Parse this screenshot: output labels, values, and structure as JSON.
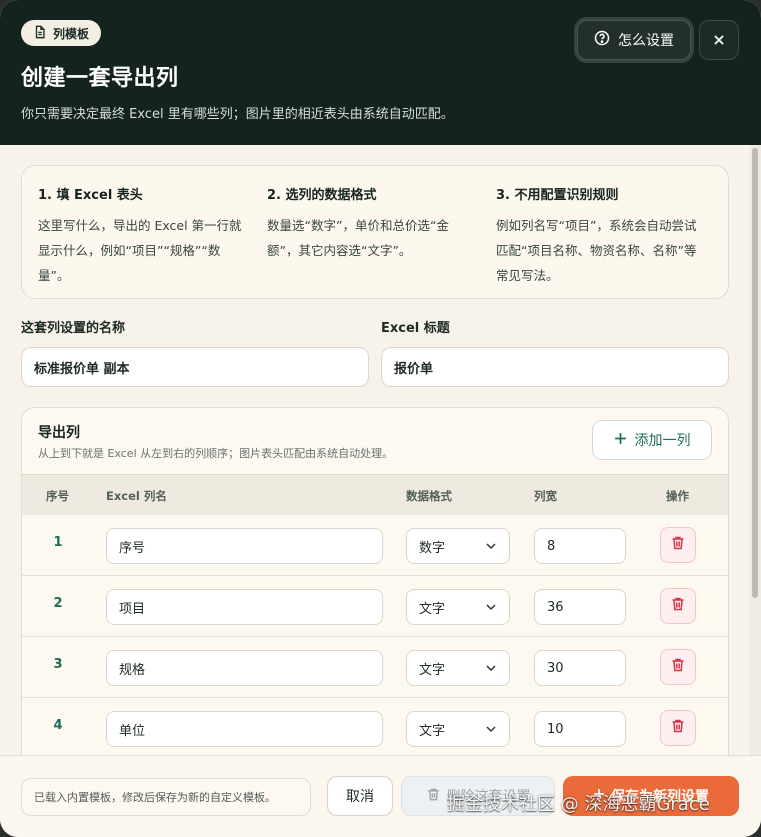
{
  "header": {
    "badge": "列模板",
    "title": "创建一套导出列",
    "subtitle": "你只需要决定最终 Excel 里有哪些列；图片里的相近表头由系统自动匹配。",
    "help_label": "怎么设置"
  },
  "steps": [
    {
      "title": "1. 填 Excel 表头",
      "body": "这里写什么，导出的 Excel 第一行就显示什么，例如“项目”“规格”“数量”。"
    },
    {
      "title": "2. 选列的数据格式",
      "body": "数量选“数字”，单价和总价选“金额”，其它内容选“文字”。"
    },
    {
      "title": "3. 不用配置识别规则",
      "body": "例如列名写“项目”，系统会自动尝试匹配“项目名称、物资名称、名称”等常见写法。"
    }
  ],
  "form": {
    "set_name_label": "这套列设置的名称",
    "set_name_value": "标准报价单 副本",
    "excel_title_label": "Excel 标题",
    "excel_title_value": "报价单"
  },
  "columns_section": {
    "title": "导出列",
    "subtitle": "从上到下就是 Excel 从左到右的列顺序；图片表头匹配由系统自动处理。",
    "add_label": "添加一列",
    "headers": [
      "序号",
      "Excel 列名",
      "数据格式",
      "列宽",
      "操作"
    ],
    "rows": [
      {
        "index": "1",
        "name": "序号",
        "format": "数字",
        "width": "8"
      },
      {
        "index": "2",
        "name": "项目",
        "format": "文字",
        "width": "36"
      },
      {
        "index": "3",
        "name": "规格",
        "format": "文字",
        "width": "30"
      },
      {
        "index": "4",
        "name": "单位",
        "format": "文字",
        "width": "10"
      }
    ]
  },
  "footer": {
    "note": "已载入内置模板，修改后保存为新的自定义模板。",
    "cancel_label": "取消",
    "delete_label": "删除这套设置",
    "save_label": "保存为新列设置",
    "watermark": "掘金技术社区 @ 深海恶霸Grace"
  },
  "colors": {
    "header_bg": "#14231e",
    "accent_green": "#1e6b58",
    "save_orange": "#ea6a3a",
    "delete_red": "#d6334a"
  }
}
